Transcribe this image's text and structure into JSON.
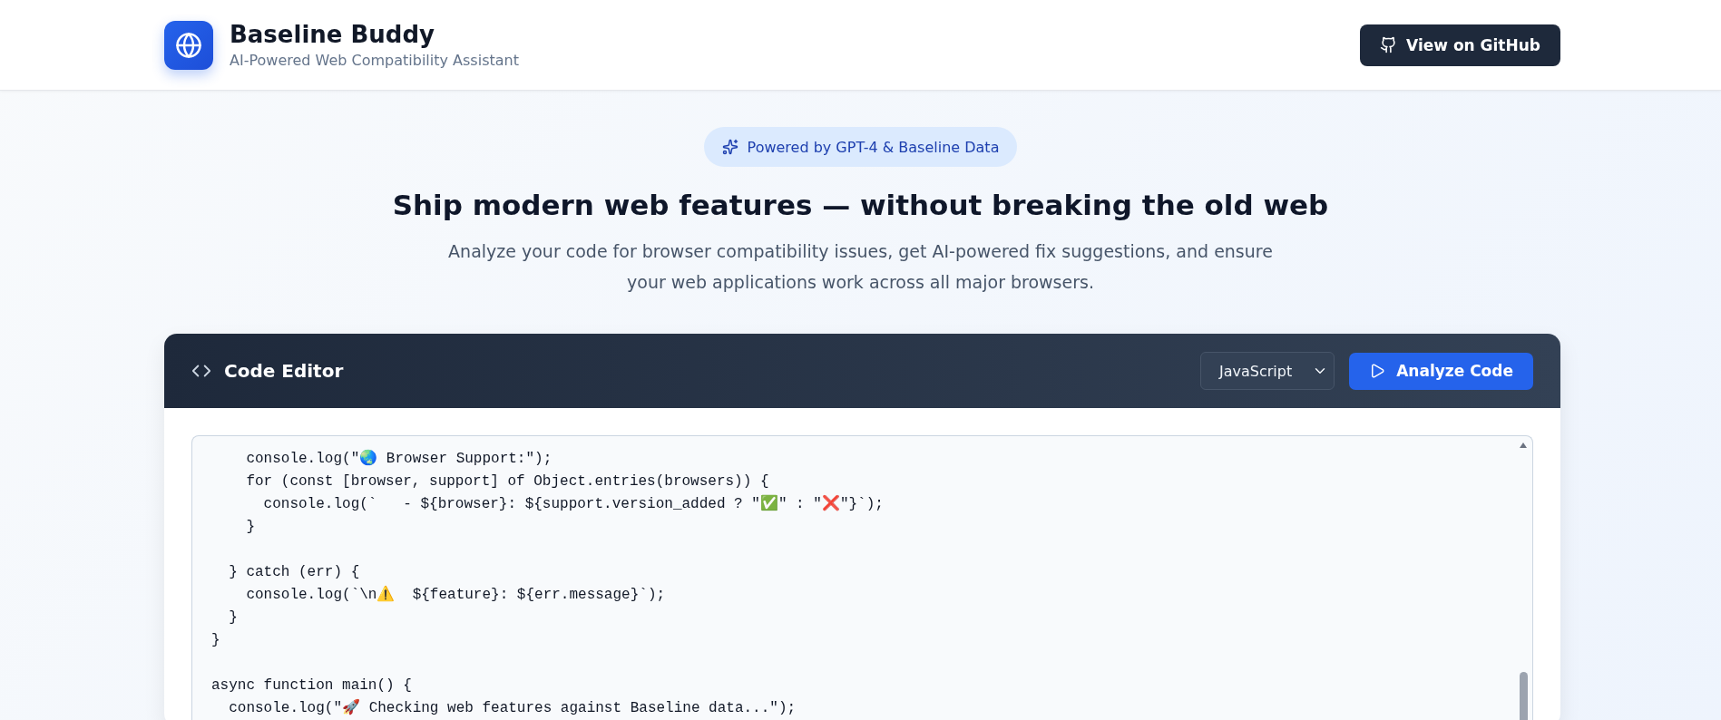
{
  "header": {
    "app_name": "Baseline Buddy",
    "tagline": "AI-Powered Web Compatibility Assistant",
    "github_button": "View on GitHub"
  },
  "hero": {
    "badge": "Powered by GPT-4 & Baseline Data",
    "heading": "Ship modern web features — without breaking the old web",
    "lines": [
      "Analyze your code for browser compatibility issues, get AI-powered fix suggestions, and ensure",
      "your web applications work across all major browsers."
    ]
  },
  "editor": {
    "title": "Code Editor",
    "language": "JavaScript",
    "analyze_button": "Analyze Code",
    "code_blocks": [
      [
        "    console.log(\"🌏 Browser Support:\");",
        "    for (const [browser, support] of Object.entries(browsers)) {",
        "      console.log(`   - ${browser}: ${support.version_added ? \"✅\" : \"❌\"}`);",
        "    }"
      ],
      [
        "  } catch (err) {",
        "    console.log(`\\n⚠️  ${feature}: ${err.message}`);",
        "  }",
        "}"
      ],
      [
        "async function main() {",
        "  console.log(\"🚀 Checking web features against Baseline data...\");"
      ]
    ]
  }
}
